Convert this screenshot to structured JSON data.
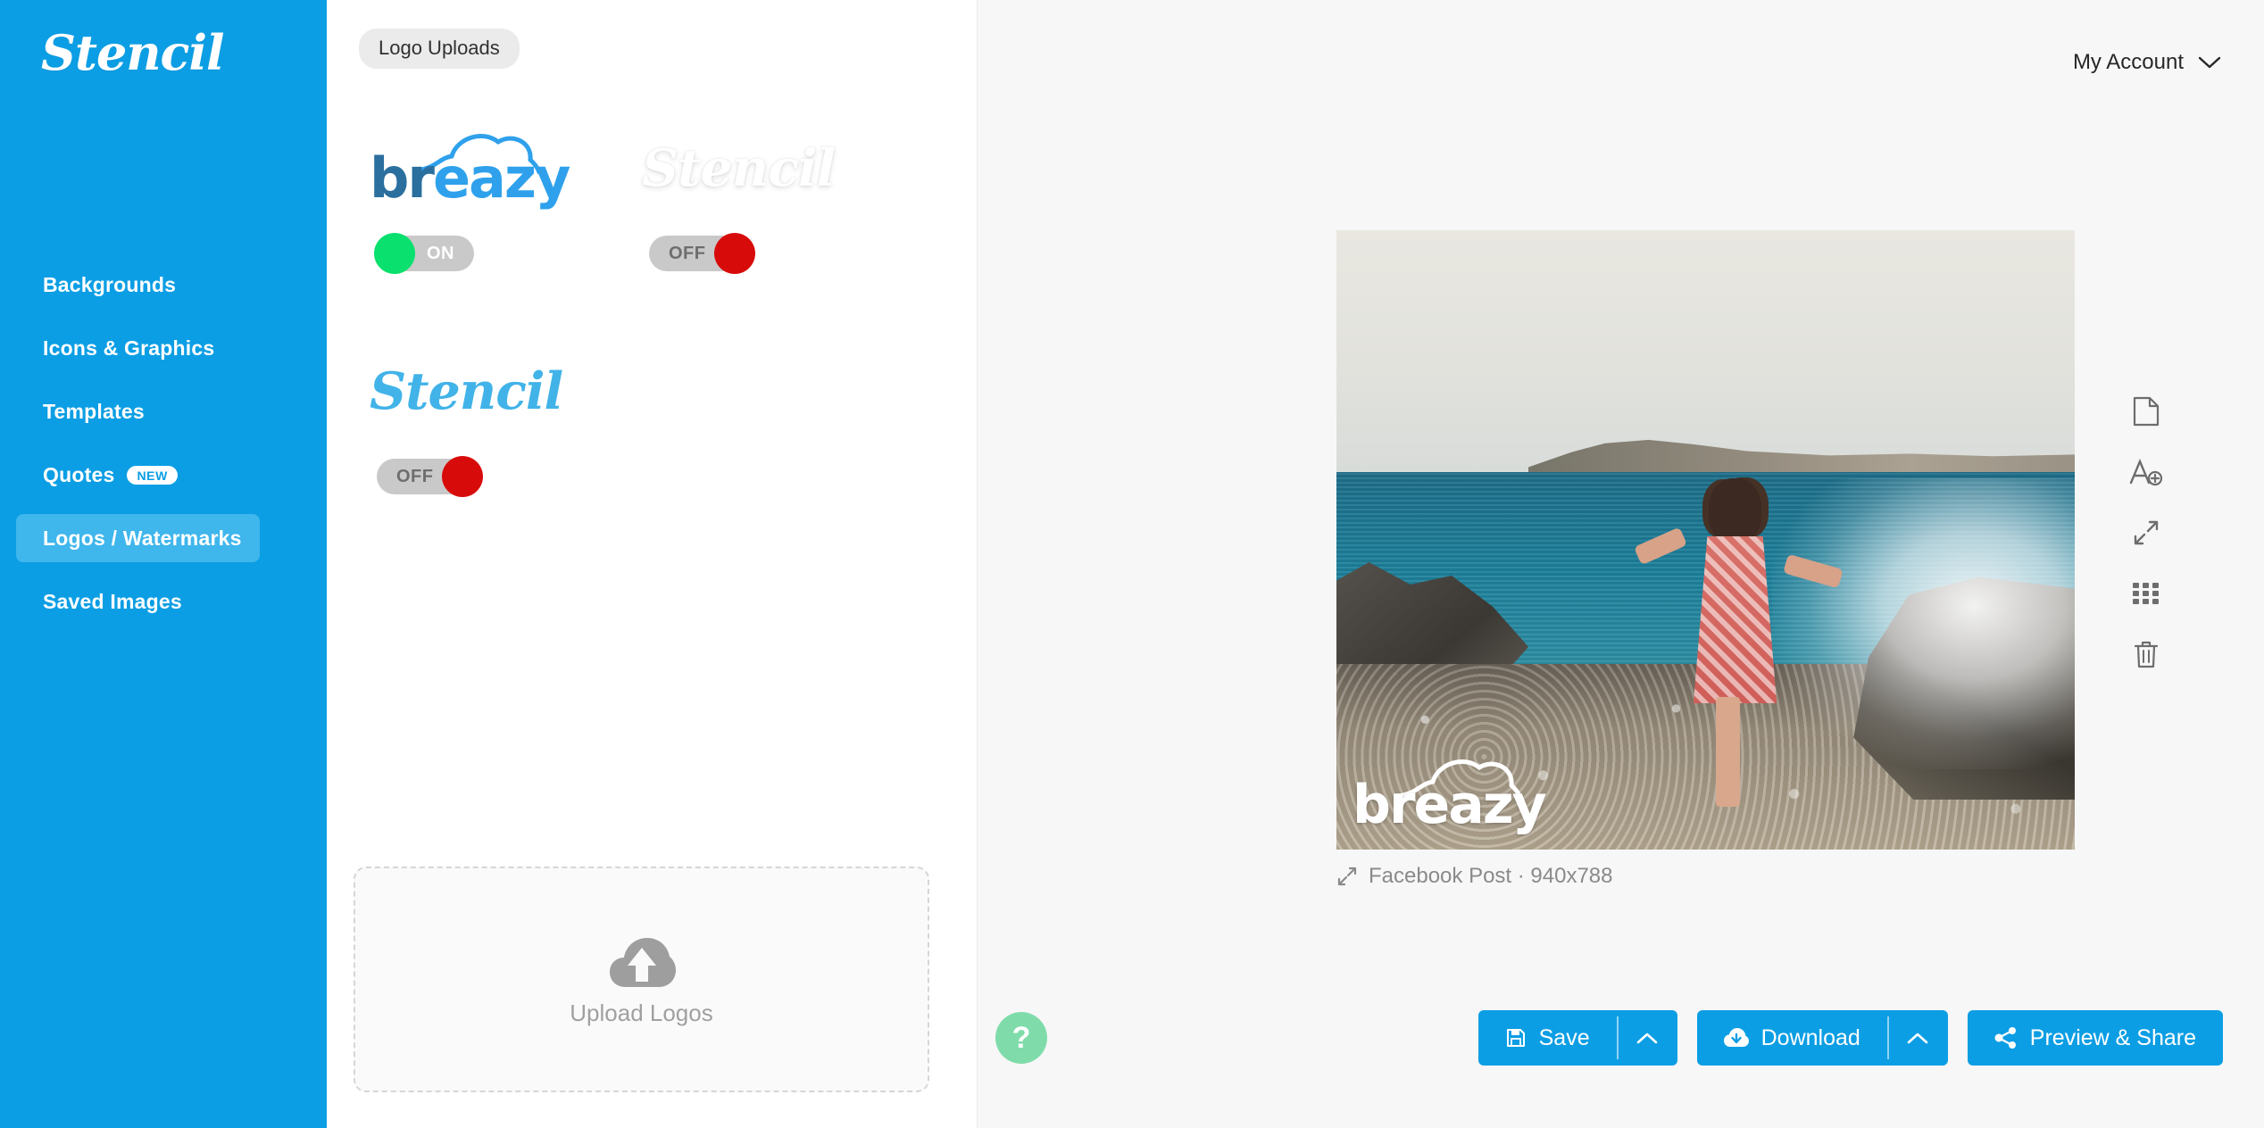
{
  "sidebar": {
    "brand": "Stencil",
    "items": [
      {
        "label": "Backgrounds",
        "active": false,
        "badge": ""
      },
      {
        "label": "Icons & Graphics",
        "active": false,
        "badge": ""
      },
      {
        "label": "Templates",
        "active": false,
        "badge": ""
      },
      {
        "label": "Quotes",
        "active": false,
        "badge": "NEW"
      },
      {
        "label": "Logos / Watermarks",
        "active": true,
        "badge": ""
      },
      {
        "label": "Saved Images",
        "active": false,
        "badge": ""
      }
    ]
  },
  "panel": {
    "tab_label": "Logo Uploads",
    "logos": [
      {
        "name": "breazy",
        "kind": "breazy",
        "state_label": "ON",
        "state": "on"
      },
      {
        "name": "Stencil",
        "kind": "stencil-white",
        "state_label": "OFF",
        "state": "off"
      },
      {
        "name": "Stencil",
        "kind": "stencil-blue",
        "state_label": "OFF",
        "state": "off"
      }
    ],
    "upload": {
      "label": "Upload Logos",
      "icon": "cloud-upload-icon"
    }
  },
  "header": {
    "account_label": "My Account",
    "account_caret": "chevron-down-icon"
  },
  "canvas": {
    "caption_label": "Facebook Post · 940x788",
    "caption_icon": "resize-icon",
    "watermark_text": "breazy",
    "photo_alt": "Woman in red patterned dress standing on rocky pebble shore, sea waves splashing, coastal town on the horizon"
  },
  "tools": [
    {
      "name": "new-page-icon",
      "title": "New"
    },
    {
      "name": "add-text-icon",
      "title": "Add Text"
    },
    {
      "name": "resize-icon",
      "title": "Resize"
    },
    {
      "name": "grid-icon",
      "title": "Grid"
    },
    {
      "name": "trash-icon",
      "title": "Delete"
    }
  ],
  "footer": {
    "help_label": "?",
    "save": {
      "label": "Save",
      "icon": "floppy-icon",
      "caret": "chevron-up-icon"
    },
    "download": {
      "label": "Download",
      "icon": "cloud-download-icon",
      "caret": "chevron-up-icon"
    },
    "preview": {
      "label": "Preview & Share",
      "icon": "share-icon"
    }
  },
  "colors": {
    "brand_blue": "#0c9ee4",
    "sidebar_active": "#3fb6ec",
    "toggle_on": "#09e06d",
    "toggle_off": "#d80b0b",
    "help_green": "#7fdcaa",
    "panel_bg": "#ffffff",
    "main_bg": "#f7f7f7"
  }
}
